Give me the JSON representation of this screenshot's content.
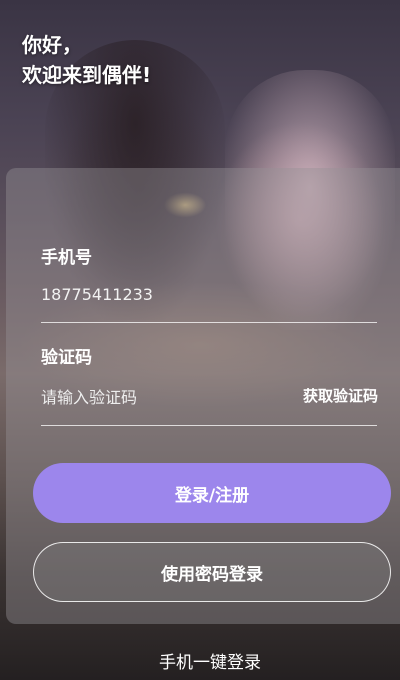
{
  "greeting": {
    "line1": "你好，",
    "line2": "欢迎来到偶伴!"
  },
  "form": {
    "phone_label": "手机号",
    "phone_value": "18775411233",
    "code_label": "验证码",
    "code_placeholder": "请输入验证码",
    "get_code_label": "获取验证码"
  },
  "actions": {
    "primary_label": "登录/注册",
    "password_login_label": "使用密码登录",
    "one_key_login_label": "手机一键登录"
  },
  "colors": {
    "primary_button": "#9c86ec",
    "text": "#ffffff"
  }
}
